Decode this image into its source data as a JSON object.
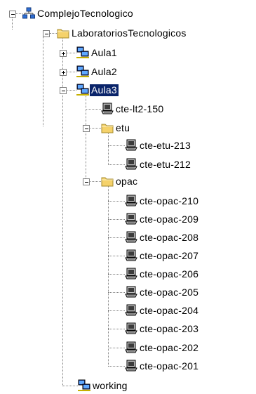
{
  "tree": {
    "root": {
      "label": "ComplejoTecnologico",
      "icon": "network-icon",
      "expanded": true
    },
    "laboratorios": {
      "label": "LaboratoriosTecnologicos",
      "icon": "folder-icon",
      "expanded": true
    },
    "aula1": {
      "label": "Aula1",
      "icon": "workgroup-icon",
      "expanded": false
    },
    "aula2": {
      "label": "Aula2",
      "icon": "workgroup-icon",
      "expanded": false
    },
    "aula3": {
      "label": "Aula3",
      "icon": "workgroup-icon",
      "expanded": true,
      "selected": true
    },
    "lt2_150": {
      "label": "cte-lt2-150",
      "icon": "computer-icon"
    },
    "etu": {
      "label": "etu",
      "icon": "folder-icon",
      "expanded": true,
      "children": [
        {
          "label": "cte-etu-213",
          "icon": "computer-icon"
        },
        {
          "label": "cte-etu-212",
          "icon": "computer-icon"
        }
      ]
    },
    "opac": {
      "label": "opac",
      "icon": "folder-icon",
      "expanded": true,
      "children": [
        {
          "label": "cte-opac-210",
          "icon": "computer-icon"
        },
        {
          "label": "cte-opac-209",
          "icon": "computer-icon"
        },
        {
          "label": "cte-opac-208",
          "icon": "computer-icon"
        },
        {
          "label": "cte-opac-207",
          "icon": "computer-icon"
        },
        {
          "label": "cte-opac-206",
          "icon": "computer-icon"
        },
        {
          "label": "cte-opac-205",
          "icon": "computer-icon"
        },
        {
          "label": "cte-opac-204",
          "icon": "computer-icon"
        },
        {
          "label": "cte-opac-203",
          "icon": "computer-icon"
        },
        {
          "label": "cte-opac-202",
          "icon": "computer-icon"
        },
        {
          "label": "cte-opac-201",
          "icon": "computer-icon"
        }
      ]
    },
    "working": {
      "label": "working",
      "icon": "workgroup-icon"
    }
  },
  "colors": {
    "selection": "#0a246a",
    "folder": "#f5d26b",
    "tree_lines": "#808080"
  }
}
